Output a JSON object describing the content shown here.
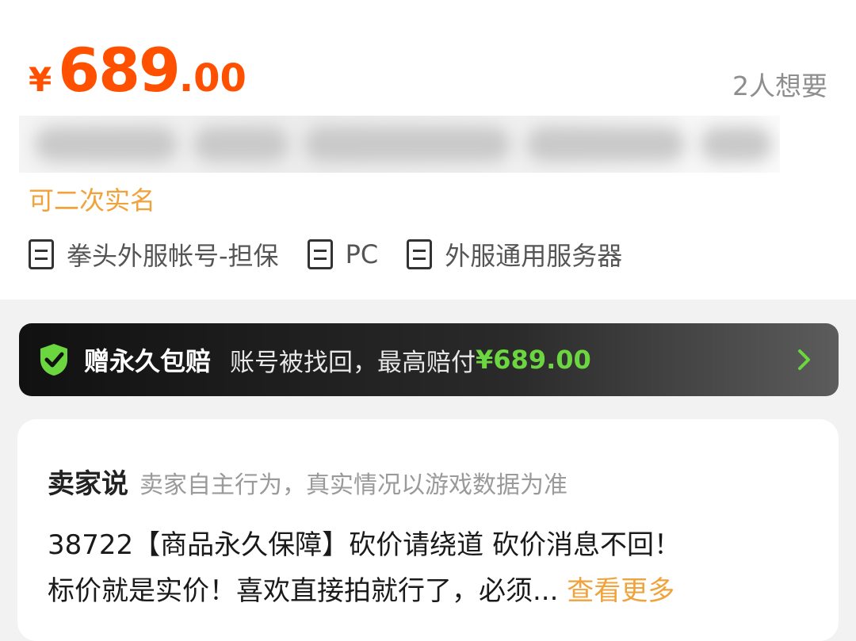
{
  "price": {
    "currency": "¥",
    "integer": "689",
    "decimal": ".00"
  },
  "wants": "2人想要",
  "sub_tag": "可二次实名",
  "tags": [
    {
      "icon": "doc-icon",
      "label": "拳头外服帐号-担保"
    },
    {
      "icon": "doc-icon",
      "label": "PC"
    },
    {
      "icon": "doc-icon",
      "label": "外服通用服务器"
    }
  ],
  "guarantee": {
    "icon": "shield-check-icon",
    "title": "赠永久包赔",
    "desc": "账号被找回，最高赔付",
    "amount": "¥689.00",
    "colors": {
      "amount": "#6bd640",
      "shield": "#6bd640"
    }
  },
  "seller": {
    "title": "卖家说",
    "note": "卖家自主行为，真实情况以游戏数据为准",
    "line1": "38722【商品永久保障】砍价请绕道 砍价消息不回！",
    "line2": "标价就是实价！喜欢直接拍就行了，必须...",
    "more": "查看更多"
  },
  "colors": {
    "price": "#ff5000",
    "accent": "#f0a23b"
  }
}
